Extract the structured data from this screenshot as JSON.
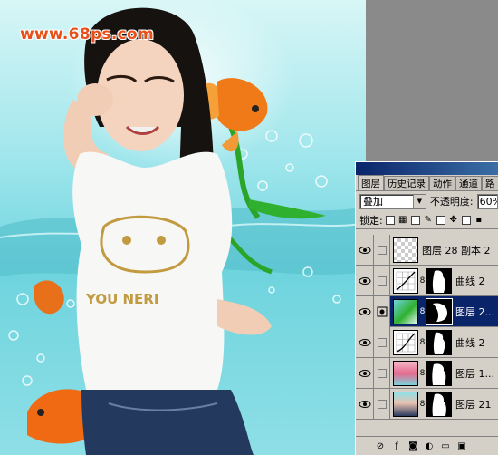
{
  "watermark": {
    "text": "www.68ps.com"
  },
  "panel": {
    "tabs": [
      {
        "label": "图层",
        "active": true
      },
      {
        "label": "历史记录",
        "active": false
      },
      {
        "label": "动作",
        "active": false
      },
      {
        "label": "通道",
        "active": false
      },
      {
        "label": "路",
        "active": false
      }
    ],
    "blend_mode": "叠加",
    "opacity_label": "不透明度:",
    "opacity_value": "60%",
    "lock_label": "锁定:",
    "layers": [
      {
        "name": "图层 28 副本 2",
        "type": "pixel",
        "selected": false
      },
      {
        "name": "曲线 2",
        "type": "curves",
        "selected": false
      },
      {
        "name": "图层 2...",
        "type": "pixel-mask",
        "selected": true
      },
      {
        "name": "曲线 2",
        "type": "curves",
        "selected": false
      },
      {
        "name": "图层 1...",
        "type": "pixel-mask",
        "selected": false
      },
      {
        "name": "图层 21",
        "type": "pixel-mask",
        "selected": false
      }
    ],
    "bottom_icons": [
      "link-icon",
      "style-icon",
      "mask-icon",
      "adjustment-icon",
      "folder-icon",
      "new-layer-icon"
    ]
  },
  "colors": {
    "selected_row": "#0a246a",
    "panel_bg": "#d4d0c8",
    "watermark": "#e8501a"
  }
}
